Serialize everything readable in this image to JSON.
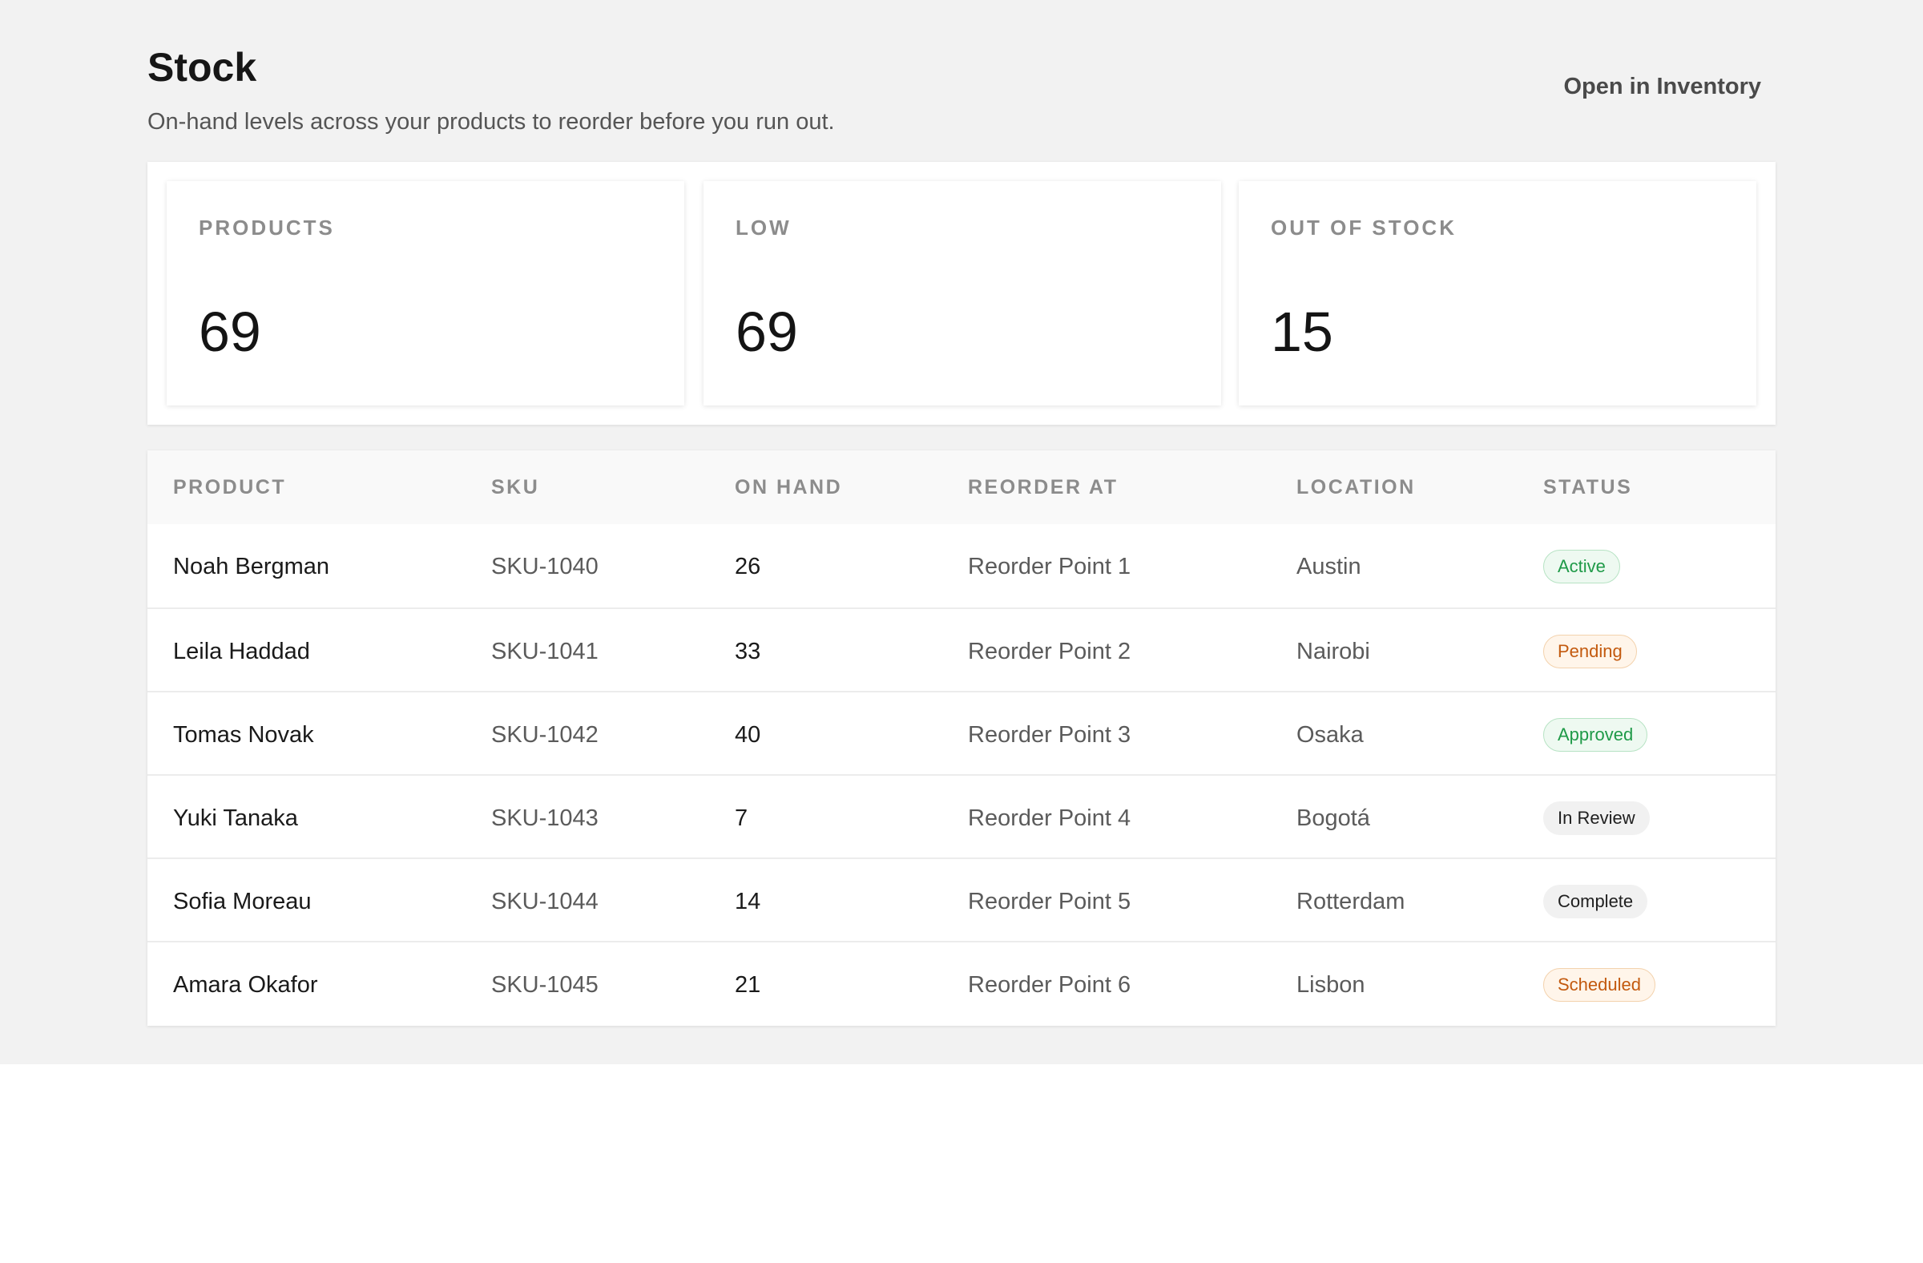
{
  "header": {
    "title": "Stock",
    "subtitle": "On-hand levels across your products to reorder before you run out.",
    "action_label": "Open in Inventory"
  },
  "kpis": [
    {
      "label": "PRODUCTS",
      "value": "69"
    },
    {
      "label": "LOW",
      "value": "69"
    },
    {
      "label": "OUT OF STOCK",
      "value": "15"
    }
  ],
  "table": {
    "columns": [
      "PRODUCT",
      "SKU",
      "ON HAND",
      "REORDER AT",
      "LOCATION",
      "STATUS"
    ],
    "rows": [
      {
        "product": "Noah Bergman",
        "sku": "SKU-1040",
        "on_hand": "26",
        "reorder_at": "Reorder Point 1",
        "location": "Austin",
        "status": "Active",
        "status_tone": "green"
      },
      {
        "product": "Leila Haddad",
        "sku": "SKU-1041",
        "on_hand": "33",
        "reorder_at": "Reorder Point 2",
        "location": "Nairobi",
        "status": "Pending",
        "status_tone": "orange"
      },
      {
        "product": "Tomas Novak",
        "sku": "SKU-1042",
        "on_hand": "40",
        "reorder_at": "Reorder Point 3",
        "location": "Osaka",
        "status": "Approved",
        "status_tone": "green"
      },
      {
        "product": "Yuki Tanaka",
        "sku": "SKU-1043",
        "on_hand": "7",
        "reorder_at": "Reorder Point 4",
        "location": "Bogotá",
        "status": "In Review",
        "status_tone": "gray"
      },
      {
        "product": "Sofia Moreau",
        "sku": "SKU-1044",
        "on_hand": "14",
        "reorder_at": "Reorder Point 5",
        "location": "Rotterdam",
        "status": "Complete",
        "status_tone": "gray"
      },
      {
        "product": "Amara Okafor",
        "sku": "SKU-1045",
        "on_hand": "21",
        "reorder_at": "Reorder Point 6",
        "location": "Lisbon",
        "status": "Scheduled",
        "status_tone": "orange"
      }
    ]
  },
  "colors": {
    "page_bg": "#f2f2f2",
    "badge_green": "#1f9a48",
    "badge_orange": "#c35a0f",
    "badge_gray": "#1f1f1f"
  }
}
